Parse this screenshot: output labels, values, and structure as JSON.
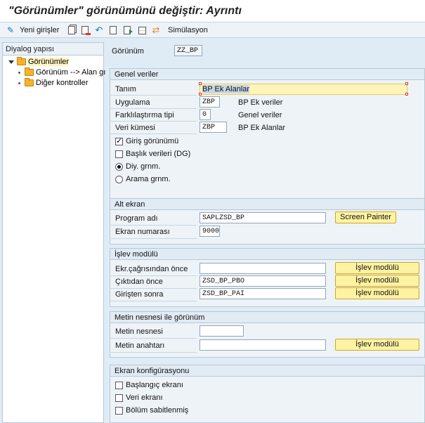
{
  "window": {
    "title": "\"Görünümler\" görünümünü değiştir: Ayrıntı"
  },
  "toolbar": {
    "new_entries": "Yeni girişler",
    "simulation": "Simülasyon",
    "icons": [
      "glasses-icon",
      "copy-icon",
      "delete-icon",
      "undo-icon",
      "prev-icon",
      "next-icon",
      "detail-icon",
      "select-all-icon",
      "simulation-icon"
    ]
  },
  "tree": {
    "header": "Diyalog yapısı",
    "items": [
      {
        "label": "Görünümler",
        "level": 0,
        "selected": true
      },
      {
        "label": "Görünüm --> Alan gı",
        "level": 1
      },
      {
        "label": "Diğer kontroller",
        "level": 1
      }
    ]
  },
  "header_field": {
    "label": "Görünüm",
    "value": "ZZ_BP"
  },
  "general": {
    "title": "Genel veriler",
    "description_label": "Tanım",
    "description_value": "BP Ek Alanlar",
    "app_label": "Uygulama",
    "app_value": "ZBP",
    "app_text": "BP Ek veriler",
    "diff_label": "Farklılaştırma tipi",
    "diff_value": "0",
    "diff_text": "Genel veriler",
    "dataset_label": "Veri kümesi",
    "dataset_value": "ZBP",
    "dataset_text": "BP Ek Alanlar",
    "entry_view": "Giriş görünümü",
    "entry_view_checked": true,
    "header_data": "Başlık verileri (DG)",
    "header_data_checked": false,
    "dialog_view": "Diy. grnm.",
    "dialog_view_selected": true,
    "search_view": "Arama grnm.",
    "search_view_selected": false
  },
  "subscreen": {
    "title": "Alt ekran",
    "program_label": "Program adı",
    "program_value": "SAPLZSD_BP",
    "screen_painter": "Screen Painter",
    "screen_no_label": "Ekran numarası",
    "screen_no_value": "9000"
  },
  "function_module": {
    "title": "İşlev modülü",
    "before_call_label": "Ekr.çağrısından önce",
    "before_call_value": "",
    "before_output_label": "Çıktıdan önce",
    "before_output_value": "ZSD_BP_PBO",
    "after_input_label": "Girişten sonra",
    "after_input_value": "ZSD_BP_PAI",
    "button_label": "İşlev modülü"
  },
  "text_object": {
    "title": "Metin nesnesi ile görünüm",
    "object_label": "Metin nesnesi",
    "object_value": "",
    "key_label": "Metin anahtarı",
    "key_value": "",
    "button_label": "İşlev modülü"
  },
  "screen_config": {
    "title": "Ekran konfigürasyonu",
    "start_screen": "Başlangıç ekranı",
    "data_screen": "Veri ekranı",
    "section_fixed": "Bölüm sabitlenmiş"
  }
}
